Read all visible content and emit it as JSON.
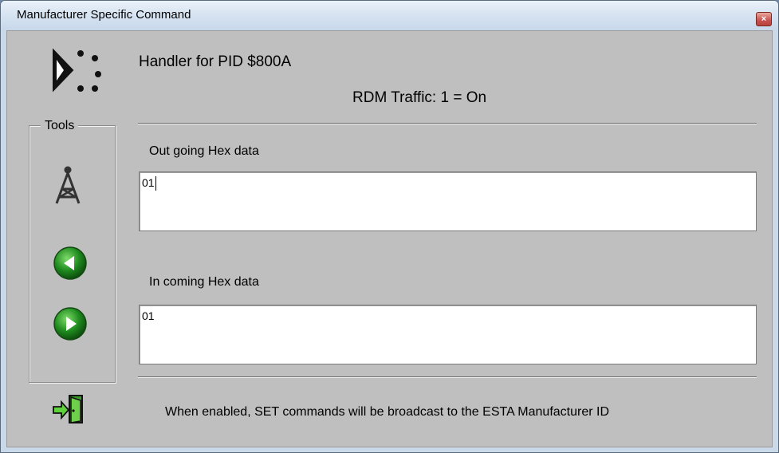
{
  "window": {
    "title": "Manufacturer Specific Command",
    "close_symbol": "×"
  },
  "header": {
    "handler_text": "Handler for PID $800A",
    "traffic_text": "RDM Traffic: 1 = On"
  },
  "tools": {
    "label": "Tools",
    "icons": [
      "antenna-tower-icon",
      "back-arrow-icon",
      "forward-arrow-icon",
      "exit-door-icon"
    ]
  },
  "outgoing": {
    "label": "Out going Hex data",
    "value": "01"
  },
  "incoming": {
    "label": "In coming Hex data",
    "value": "01"
  },
  "footer": {
    "note": "When enabled, SET commands will be broadcast to the  ESTA Manufacturer ID"
  },
  "colors": {
    "arrow_green": "#1e8a1e",
    "client_bg": "#bfbfbf"
  }
}
